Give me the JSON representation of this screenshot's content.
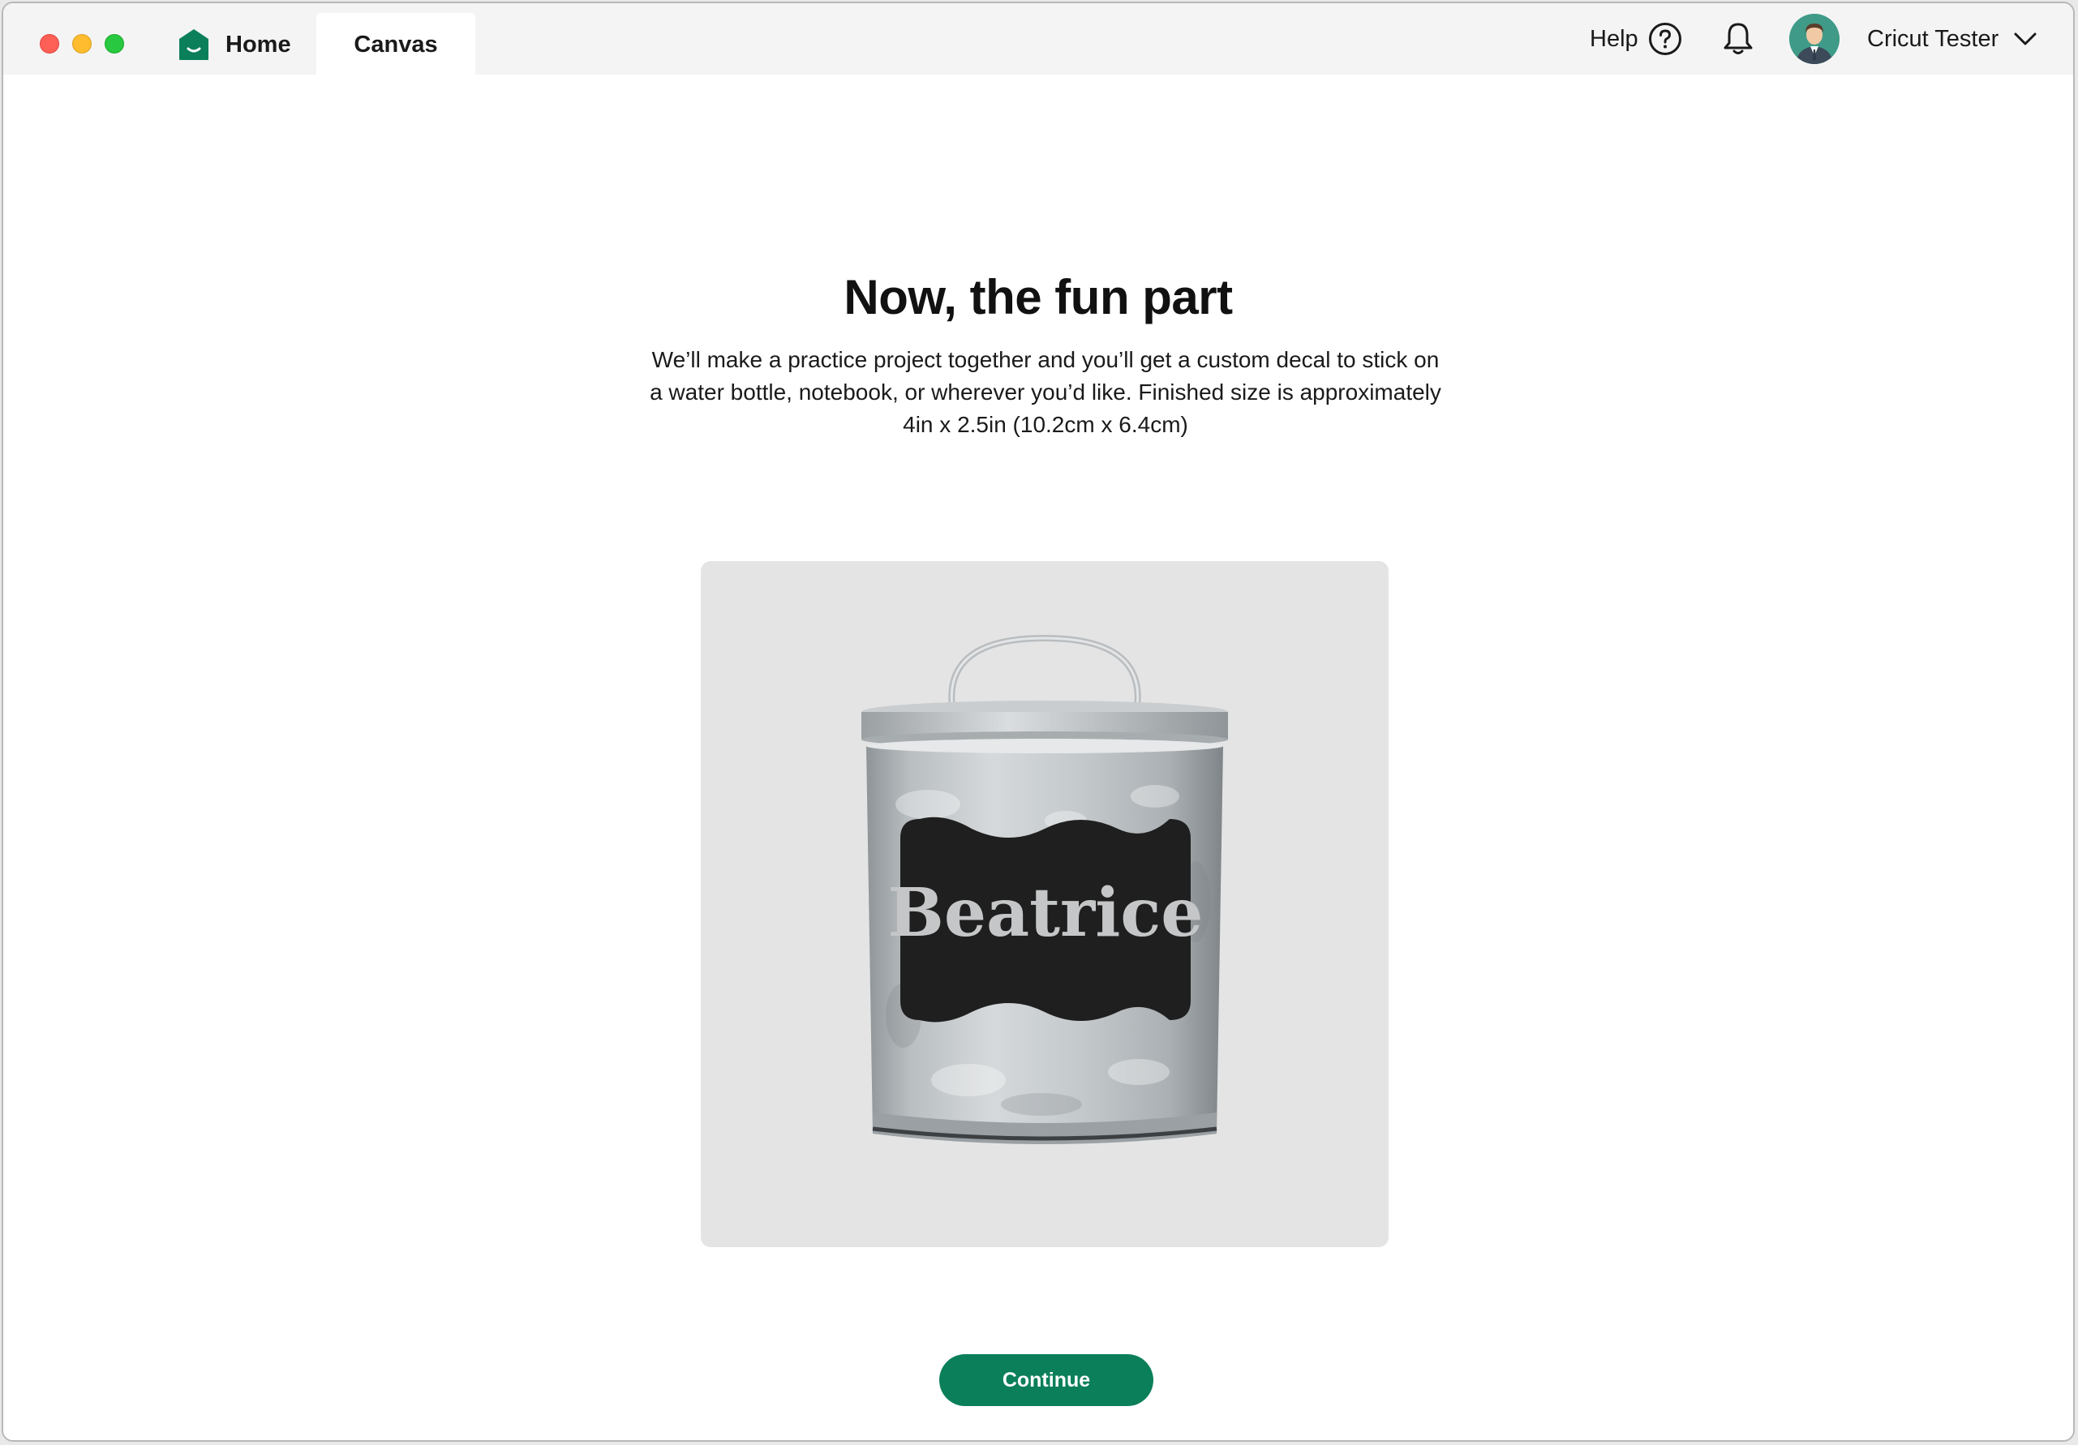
{
  "window": {
    "traffic_lights": [
      "close",
      "minimize",
      "maximize"
    ]
  },
  "header": {
    "tabs": [
      {
        "label": "Home",
        "icon": "home-icon"
      },
      {
        "label": "Canvas"
      }
    ],
    "help_label": "Help",
    "user_name": "Cricut Tester"
  },
  "main": {
    "title": "Now, the fun part",
    "description": "We’ll make a practice project together and you’ll get a custom decal to stick on a water bottle, notebook, or wherever you’d like. Finished size is approximately 4in x 2.5in (10.2cm x 6.4cm)",
    "image": {
      "decal_text": "Beatrice"
    },
    "continue_label": "Continue"
  },
  "colors": {
    "brand_green": "#0b7f5a",
    "card_bg": "#e4e4e4"
  }
}
